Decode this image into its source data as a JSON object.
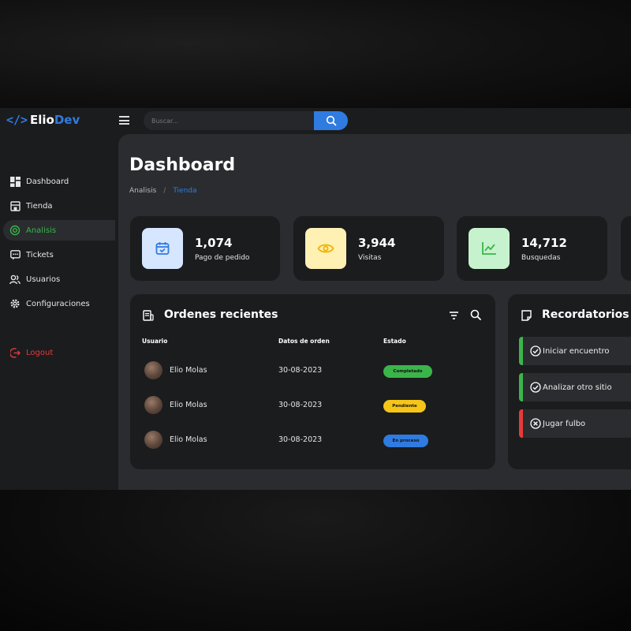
{
  "brand": {
    "icon": "</>",
    "name_a": "Elio",
    "name_b": "Dev"
  },
  "search": {
    "placeholder": "Buscar..."
  },
  "sidebar": {
    "items": [
      {
        "label": "Dashboard",
        "icon": "dashboard-icon"
      },
      {
        "label": "Tienda",
        "icon": "store-icon"
      },
      {
        "label": "Analisis",
        "icon": "analytics-icon"
      },
      {
        "label": "Tickets",
        "icon": "message-icon"
      },
      {
        "label": "Usuarios",
        "icon": "users-icon"
      },
      {
        "label": "Configuraciones",
        "icon": "gear-icon"
      }
    ],
    "logout": "Logout"
  },
  "main": {
    "title": "Dashboard",
    "breadcrumb": {
      "first": "Analisis",
      "separator": "/",
      "current": "Tienda"
    },
    "stats": [
      {
        "value": "1,074",
        "label": "Pago de pedido",
        "icon": "calendar-check-icon",
        "bg": "#d6e6ff",
        "color": "#2f7be0"
      },
      {
        "value": "3,944",
        "label": "Visitas",
        "icon": "eye-icon",
        "bg": "#fff0b3",
        "color": "#f0b400"
      },
      {
        "value": "14,712",
        "label": "Busquedas",
        "icon": "line-chart-icon",
        "bg": "#c6f3cd",
        "color": "#3bb54a"
      }
    ]
  },
  "orders": {
    "title": "Ordenes recientes",
    "columns": {
      "user": "Usuario",
      "date": "Datos de orden",
      "status": "Estado"
    },
    "rows": [
      {
        "user": "Elio Molas",
        "date": "30-08-2023",
        "status": "Completado",
        "status_color": "#3bb54a"
      },
      {
        "user": "Elio Molas",
        "date": "30-08-2023",
        "status": "Pendiente",
        "status_color": "#f5c518"
      },
      {
        "user": "Elio Molas",
        "date": "30-08-2023",
        "status": "En proceso",
        "status_color": "#2f7be0"
      }
    ]
  },
  "reminders": {
    "title": "Recordatorios",
    "items": [
      {
        "label": "Iniciar encuentro",
        "icon": "check-circle-icon",
        "color": "#3bb54a"
      },
      {
        "label": "Analizar otro sitio",
        "icon": "check-circle-icon",
        "color": "#3bb54a"
      },
      {
        "label": "Jugar fulbo",
        "icon": "x-circle-icon",
        "color": "#e53b3b"
      }
    ]
  },
  "colors": {
    "accent": "#2f7be0",
    "active": "#3bb54a",
    "danger": "#e53b3b"
  }
}
